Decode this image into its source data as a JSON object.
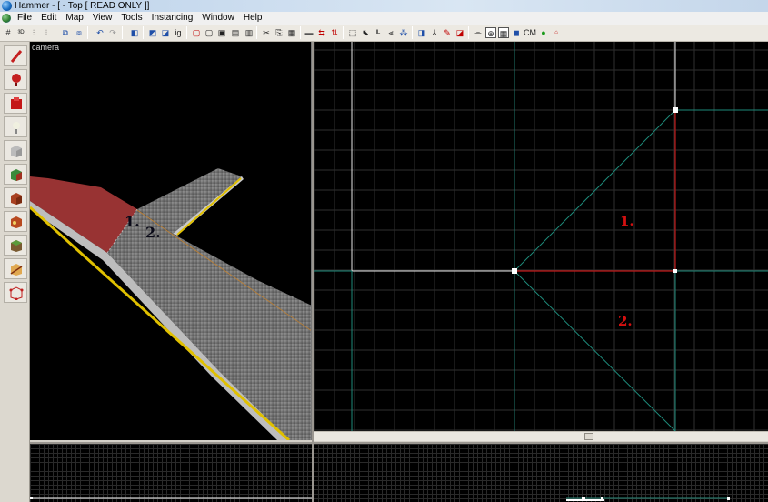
{
  "window": {
    "title": "Hammer - [ - Top [ READ ONLY ]]"
  },
  "menu": [
    "File",
    "Edit",
    "Map",
    "View",
    "Tools",
    "Instancing",
    "Window",
    "Help"
  ],
  "toolbar": {
    "cordon_label": "CM"
  },
  "camera_view": {
    "label": "camera",
    "annotation_1": "1.",
    "annotation_2": "2."
  },
  "top_view": {
    "annotation_1": "1.",
    "annotation_2": "2."
  },
  "tools": [
    "selection-tool-icon",
    "magnify-tool-icon",
    "camera-tool-icon",
    "entity-tool-icon",
    "block-tool-icon",
    "texture-application-icon",
    "apply-current-texture-icon",
    "decal-tool-icon",
    "overlay-tool-icon",
    "clipping-tool-icon",
    "vertex-tool-icon"
  ],
  "colors": {
    "grid_line": "#2f2f2f",
    "brush_outline": "#1e8a7a",
    "selected_edge": "#c01818",
    "annotation_red": "#d41010",
    "road_asphalt": "#6e6e6e",
    "road_highlight": "#b03030",
    "road_edge_yellow": "#e0c000"
  }
}
